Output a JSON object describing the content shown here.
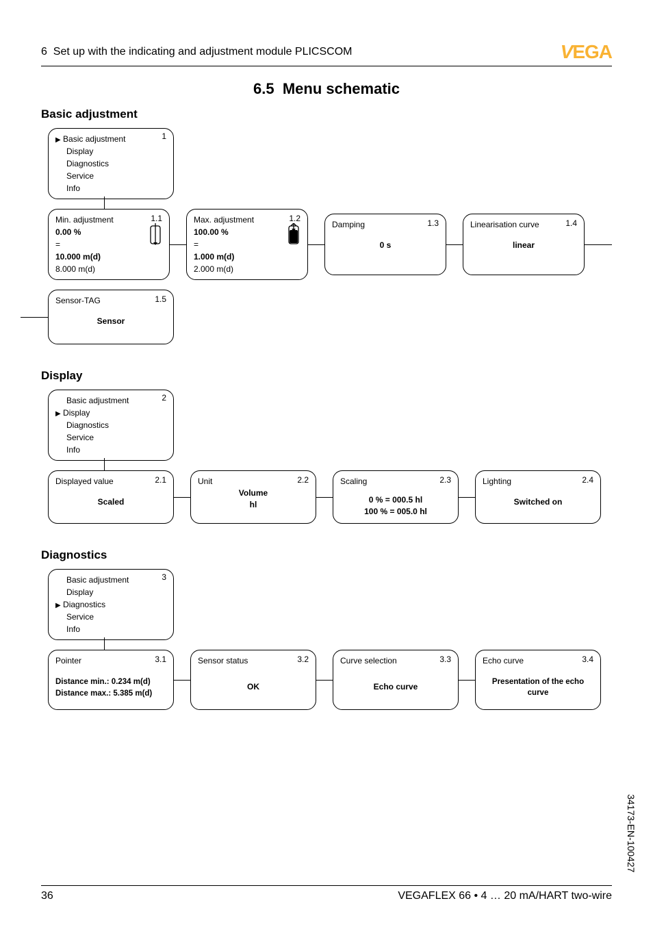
{
  "header": {
    "chapter": "6",
    "title": "Set up with the indicating and adjustment module PLICSCOM",
    "logo_v": "V",
    "logo_rest": "EGA"
  },
  "section": {
    "number": "6.5",
    "title": "Menu schematic"
  },
  "groups": {
    "basic": {
      "heading": "Basic adjustment",
      "root": {
        "num": "1",
        "items": [
          "Basic adjustment",
          "Display",
          "Diagnostics",
          "Service",
          "Info"
        ],
        "active_index": 0
      },
      "box_1_1": {
        "num": "1.1",
        "title": "Min. adjustment",
        "percent": "0.00 %",
        "eq": "=",
        "value": "10.000 m(d)",
        "extra": "8.000 m(d)"
      },
      "box_1_2": {
        "num": "1.2",
        "title": "Max. adjustment",
        "percent": "100.00 %",
        "eq": "=",
        "value": "1.000 m(d)",
        "extra": "2.000 m(d)"
      },
      "box_1_3": {
        "num": "1.3",
        "title": "Damping",
        "value": "0 s"
      },
      "box_1_4": {
        "num": "1.4",
        "title": "Linearisation curve",
        "value": "linear"
      },
      "box_1_5": {
        "num": "1.5",
        "title": "Sensor-TAG",
        "value": "Sensor"
      }
    },
    "display": {
      "heading": "Display",
      "root": {
        "num": "2",
        "items": [
          "Basic adjustment",
          "Display",
          "Diagnostics",
          "Service",
          "Info"
        ],
        "active_index": 1
      },
      "box_2_1": {
        "num": "2.1",
        "title": "Displayed value",
        "value": "Scaled"
      },
      "box_2_2": {
        "num": "2.2",
        "title": "Unit",
        "line1": "Volume",
        "line2": "hl"
      },
      "box_2_3": {
        "num": "2.3",
        "title": "Scaling",
        "line1": "0 % = 000.5 hl",
        "line2": "100 % = 005.0 hl"
      },
      "box_2_4": {
        "num": "2.4",
        "title": "Lighting",
        "value": "Switched on"
      }
    },
    "diagnostics": {
      "heading": "Diagnostics",
      "root": {
        "num": "3",
        "items": [
          "Basic adjustment",
          "Display",
          "Diagnostics",
          "Service",
          "Info"
        ],
        "active_index": 2
      },
      "box_3_1": {
        "num": "3.1",
        "title": "Pointer",
        "line1": "Distance min.: 0.234 m(d)",
        "line2": "Distance max.: 5.385 m(d)"
      },
      "box_3_2": {
        "num": "3.2",
        "title": "Sensor status",
        "value": "OK"
      },
      "box_3_3": {
        "num": "3.3",
        "title": "Curve selection",
        "value": "Echo curve"
      },
      "box_3_4": {
        "num": "3.4",
        "title": "Echo curve",
        "line1": "Presentation of the echo",
        "line2": "curve"
      }
    }
  },
  "footer": {
    "page": "36",
    "doc": "VEGAFLEX 66 • 4 … 20 mA/HART two-wire"
  },
  "side": "34173-EN-100427"
}
